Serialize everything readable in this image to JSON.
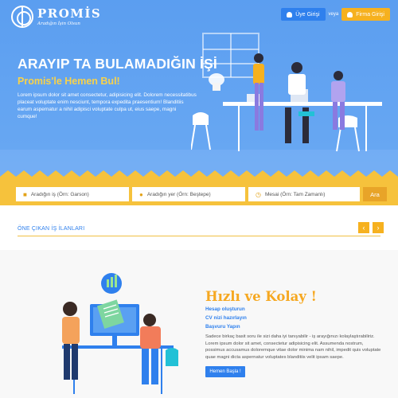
{
  "brand": {
    "name": "PROMİS",
    "tagline": "Aradığın İşin Olsun"
  },
  "auth": {
    "member_label": "Üye Girişi",
    "or_label": "veya",
    "firm_label": "Firma Girişi"
  },
  "hero": {
    "title": "ARAYIP TA BULAMADIĞIN İŞİ",
    "subtitle": "Promis'le Hemen Bul!",
    "description": "Lorem ipsum dolor sit amet consectetur, adipisicing elit. Dolorem necessitatibus placeat voluptate enim nesciunt, tempora expedita praesentium! Blanditiis earum aspernatur a nihil adipisci voluptate culpa ut, eius saepe, magni cumque!"
  },
  "search": {
    "job_placeholder": "Aradığın iş (Örn: Garson)",
    "place_placeholder": "Aradığın yer (Örn: Beştepe)",
    "shift_placeholder": "Mesai (Örn: Tam Zamanlı)",
    "button_label": "Ara"
  },
  "featured": {
    "title": "ÖNE ÇIKAN İŞ İLANLARI",
    "prev": "‹",
    "next": "›"
  },
  "info": {
    "title": "Hızlı ve Kolay !",
    "steps": [
      "Hesap oluşturun",
      "CV nizi hazırlayın",
      "Başvuru Yapın"
    ],
    "description": "Sadece birkaç basit soru ile sizi daha iyi tanıyabilir - iş arayığınızı kolaylaştırabiliriz. Lorem ipsum dolor sit amet, consectetur adipisicing elit. Assumenda nostrum, possimus accusamus doloremque vitae dolor minima nam nihil, impedit quis voluptate quae magni dicta aspernatur voluptates blanditiis velit ipsam saepe.",
    "button_label": "Hemen Başla !"
  },
  "colors": {
    "hero_blue": "#5b9ef0",
    "accent_yellow": "#f6b11f",
    "primary_blue": "#2f80ed"
  }
}
